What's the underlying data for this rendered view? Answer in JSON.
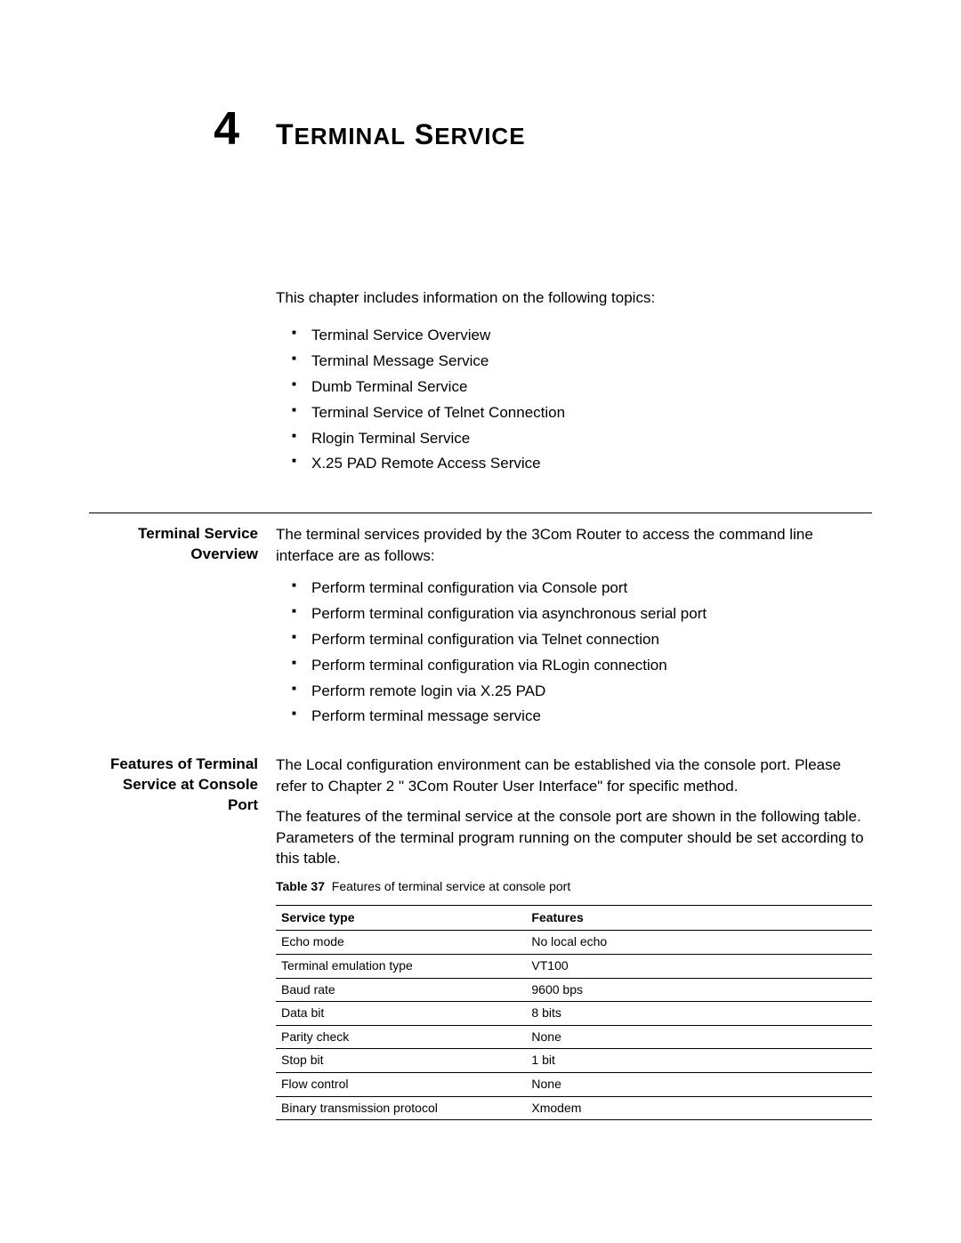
{
  "chapter": {
    "number": "4",
    "title_cap1": "T",
    "title_rest1": "ERMINAL",
    "title_cap2": "S",
    "title_rest2": "ERVICE"
  },
  "intro": {
    "lead": "This chapter includes information on the following topics:",
    "topics": [
      "Terminal Service Overview",
      "Terminal Message Service",
      "Dumb Terminal Service",
      "Terminal Service of Telnet Connection",
      "Rlogin Terminal Service",
      "X.25 PAD Remote Access Service"
    ]
  },
  "section1": {
    "label": "Terminal Service Overview",
    "para": "The terminal services provided by the 3Com Router to access the command line interface are as follows:",
    "bullets": [
      "Perform terminal configuration via Console port",
      "Perform terminal configuration via asynchronous serial port",
      "Perform terminal configuration via Telnet connection",
      "Perform terminal configuration via RLogin connection",
      "Perform remote login via X.25 PAD",
      "Perform terminal message service"
    ]
  },
  "section2": {
    "label": "Features of Terminal Service at Console Port",
    "para1": "The Local configuration environment can be established via the console port. Please refer to Chapter 2 \" 3Com Router User Interface\" for specific method.",
    "para2": "The features of the terminal service at the console port are shown in the following table. Parameters of the terminal program running on the computer should be set according to this table.",
    "table_caption_label": "Table 37",
    "table_caption_text": "Features of terminal service at console port",
    "headers": {
      "col1": "Service type",
      "col2": "Features"
    },
    "rows": [
      {
        "c1": "Echo mode",
        "c2": "No local echo"
      },
      {
        "c1": "Terminal emulation type",
        "c2": "VT100"
      },
      {
        "c1": "Baud rate",
        "c2": "9600 bps"
      },
      {
        "c1": "Data bit",
        "c2": "8 bits"
      },
      {
        "c1": "Parity check",
        "c2": "None"
      },
      {
        "c1": "Stop bit",
        "c2": "1 bit"
      },
      {
        "c1": "Flow control",
        "c2": "None"
      },
      {
        "c1": "Binary transmission protocol",
        "c2": "Xmodem"
      }
    ]
  }
}
